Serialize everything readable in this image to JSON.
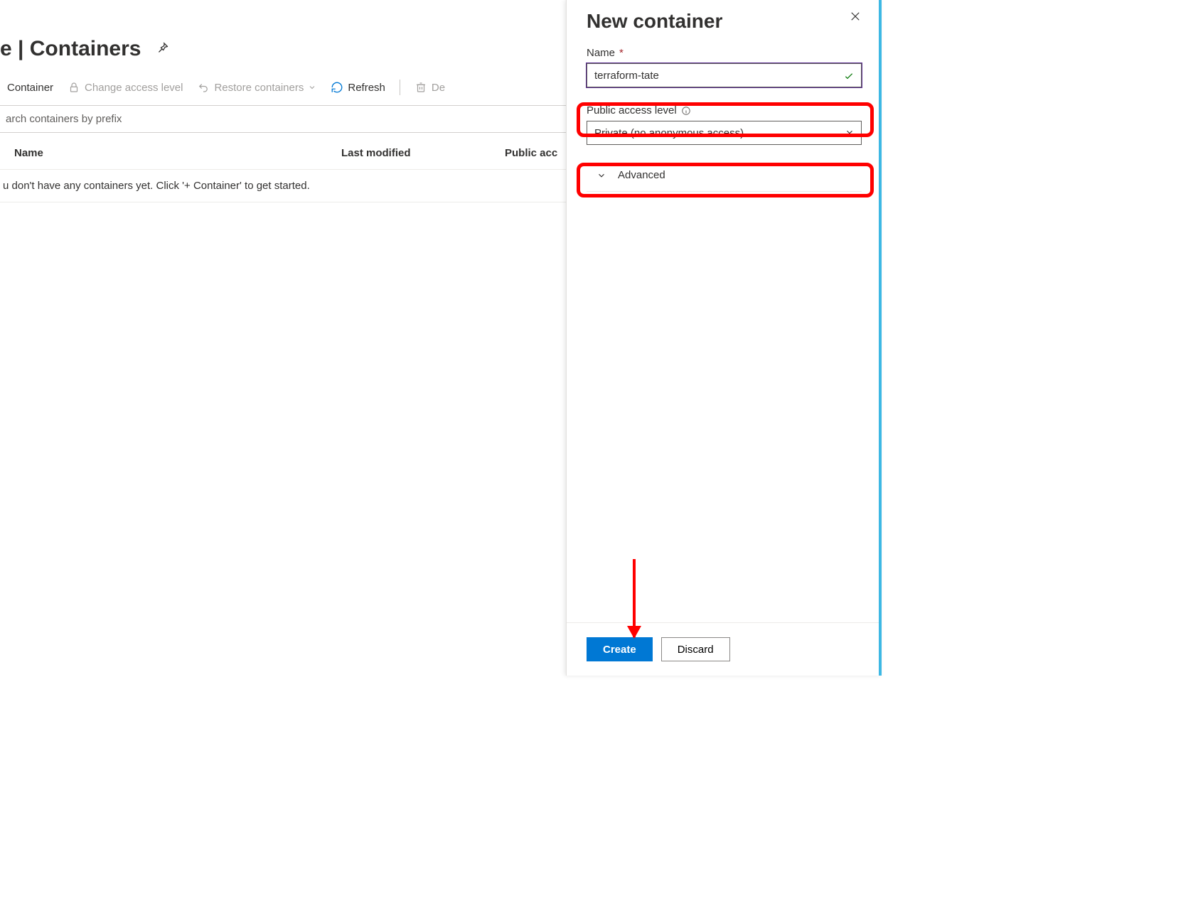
{
  "page": {
    "title_prefix": "e",
    "title_sep": " | ",
    "title": "Containers"
  },
  "toolbar": {
    "container": "Container",
    "change_access": "Change access level",
    "restore": "Restore containers",
    "refresh": "Refresh",
    "delete": "De"
  },
  "search": {
    "placeholder": "arch containers by prefix"
  },
  "table": {
    "col_name": "Name",
    "col_modified": "Last modified",
    "col_access": "Public acc",
    "empty": "u don't have any containers yet. Click '+ Container' to get started."
  },
  "panel": {
    "title": "New container",
    "name_label": "Name",
    "name_value": "terraform-tate",
    "access_label": "Public access level",
    "access_value": "Private (no anonymous access)",
    "advanced": "Advanced",
    "create": "Create",
    "discard": "Discard"
  }
}
